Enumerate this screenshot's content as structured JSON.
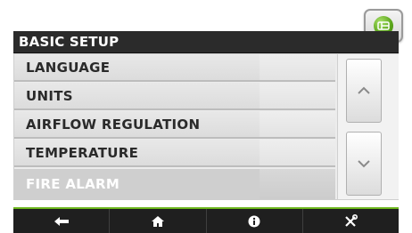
{
  "header": {
    "title": "BASIC SETUP",
    "home_button_icon": "green-home-icon"
  },
  "menu": {
    "items": [
      {
        "label": "LANGUAGE"
      },
      {
        "label": "UNITS"
      },
      {
        "label": "AIRFLOW REGULATION"
      },
      {
        "label": "TEMPERATURE"
      },
      {
        "label": "FIRE ALARM"
      }
    ]
  },
  "scroll": {
    "up_icon": "chevron-up-icon",
    "down_icon": "chevron-down-icon"
  },
  "navbar": {
    "buttons": [
      {
        "icon": "back-arrow-icon"
      },
      {
        "icon": "home-icon"
      },
      {
        "icon": "info-icon"
      },
      {
        "icon": "tools-icon"
      }
    ]
  },
  "colors": {
    "accent_green": "#6cb61b",
    "titlebar": "#2b2b2b",
    "navbar": "#1f1f1f"
  }
}
